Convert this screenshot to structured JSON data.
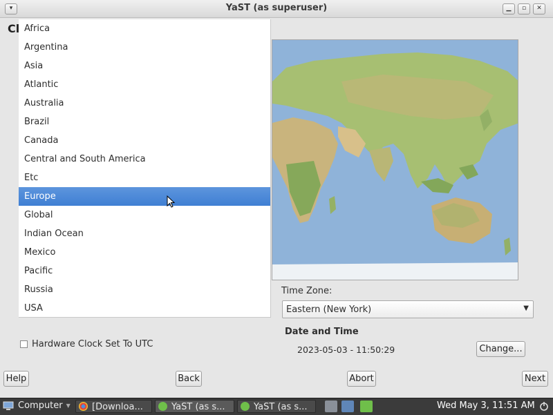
{
  "window": {
    "title": "YaST (as superuser)"
  },
  "heading": "Cl",
  "regions": {
    "items": [
      "Africa",
      "Argentina",
      "Asia",
      "Atlantic",
      "Australia",
      "Brazil",
      "Canada",
      "Central and South America",
      "Etc",
      "Europe",
      "Global",
      "Indian Ocean",
      "Mexico",
      "Pacific",
      "Russia",
      "USA"
    ],
    "selected": "Europe"
  },
  "timezone": {
    "label": "Time Zone:",
    "value": "Eastern (New York)"
  },
  "date_time": {
    "title": "Date and Time",
    "value": "2023-05-03 - 11:50:29",
    "change_label": "Change..."
  },
  "hardware_clock": {
    "label": "Hardware Clock Set To UTC",
    "checked": false
  },
  "buttons": {
    "help": "Help",
    "back": "Back",
    "abort": "Abort",
    "next": "Next"
  },
  "taskbar": {
    "start_label": "Computer",
    "tasks": [
      "[Downloa...",
      "YaST (as s...",
      "YaST (as s..."
    ],
    "clock": "Wed May  3, 11:51 AM"
  },
  "colors": {
    "selection": "#3f7fd3",
    "ocean": "#8fb3d9",
    "land": "#9fba6b"
  }
}
